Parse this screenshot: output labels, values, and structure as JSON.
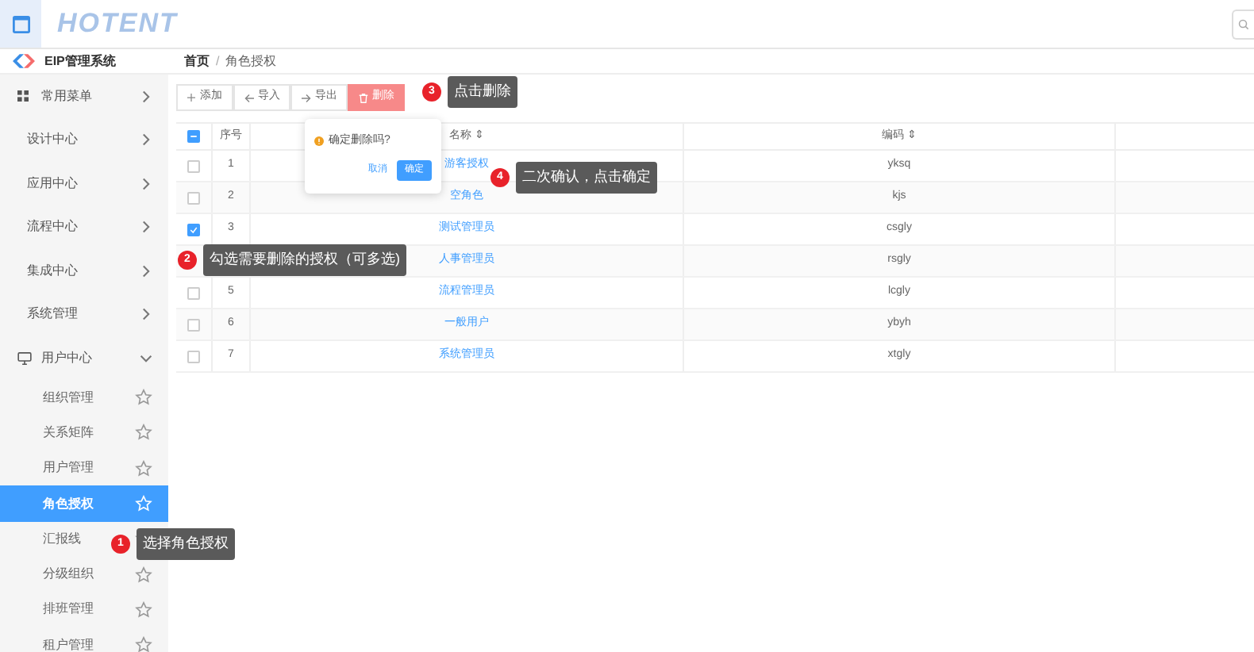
{
  "header": {
    "logo": "HOTENT"
  },
  "sidebar": {
    "system": "EIP管理系统",
    "items": [
      {
        "label": "常用菜单",
        "kind": "favorites",
        "expanded": false
      },
      {
        "label": "设计中心",
        "kind": "plain",
        "expanded": false
      },
      {
        "label": "应用中心",
        "kind": "plain",
        "expanded": false
      },
      {
        "label": "流程中心",
        "kind": "plain",
        "expanded": false
      },
      {
        "label": "集成中心",
        "kind": "plain",
        "expanded": false
      },
      {
        "label": "系统管理",
        "kind": "plain",
        "expanded": false
      },
      {
        "label": "用户中心",
        "kind": "monitor",
        "expanded": true,
        "children": [
          {
            "label": "组织管理",
            "selected": false
          },
          {
            "label": "关系矩阵",
            "selected": false
          },
          {
            "label": "用户管理",
            "selected": false
          },
          {
            "label": "角色授权",
            "selected": true
          },
          {
            "label": "汇报线",
            "selected": false
          },
          {
            "label": "分级组织",
            "selected": false
          },
          {
            "label": "排班管理",
            "selected": false
          },
          {
            "label": "租户管理",
            "selected": false
          }
        ]
      }
    ]
  },
  "breadcrumb": [
    "首页",
    "/",
    "角色授权"
  ],
  "toolbar": [
    {
      "label": "添加",
      "kind": "default"
    },
    {
      "label": "导入",
      "kind": "default"
    },
    {
      "label": "导出",
      "kind": "default"
    },
    {
      "label": "删除",
      "kind": "danger"
    }
  ],
  "table": {
    "select_all": {
      "indeterminate": true
    },
    "columns": [
      "序号",
      "名称 ⇕",
      "编码 ⇕"
    ],
    "rows": [
      {
        "seq": "1",
        "name": "游客授权",
        "code": "yksq",
        "checked": false
      },
      {
        "seq": "2",
        "name": "空角色",
        "code": "kjs",
        "checked": false
      },
      {
        "seq": "3",
        "name": "测试管理员",
        "code": "csgly",
        "checked": true
      },
      {
        "name": "人事管理员",
        "code": "rsgly"
      },
      {
        "seq": "5",
        "name": "流程管理员",
        "code": "lcgly",
        "checked": false
      },
      {
        "seq": "6",
        "name": "一般用户",
        "code": "ybyh",
        "checked": false
      },
      {
        "seq": "7",
        "name": "系统管理员",
        "code": "xtgly",
        "checked": false
      }
    ]
  },
  "popconfirm": {
    "message": "确定删除吗?",
    "cancel": "取消",
    "confirm": "确定"
  },
  "annotations": [
    {
      "number": "1",
      "text": "选择角色授权"
    },
    {
      "number": "2",
      "text": "勾选需要删除的授权（可多选)"
    },
    {
      "number": "3",
      "text": "点击删除"
    },
    {
      "number": "4",
      "text": "二次确认，点击确定"
    }
  ]
}
